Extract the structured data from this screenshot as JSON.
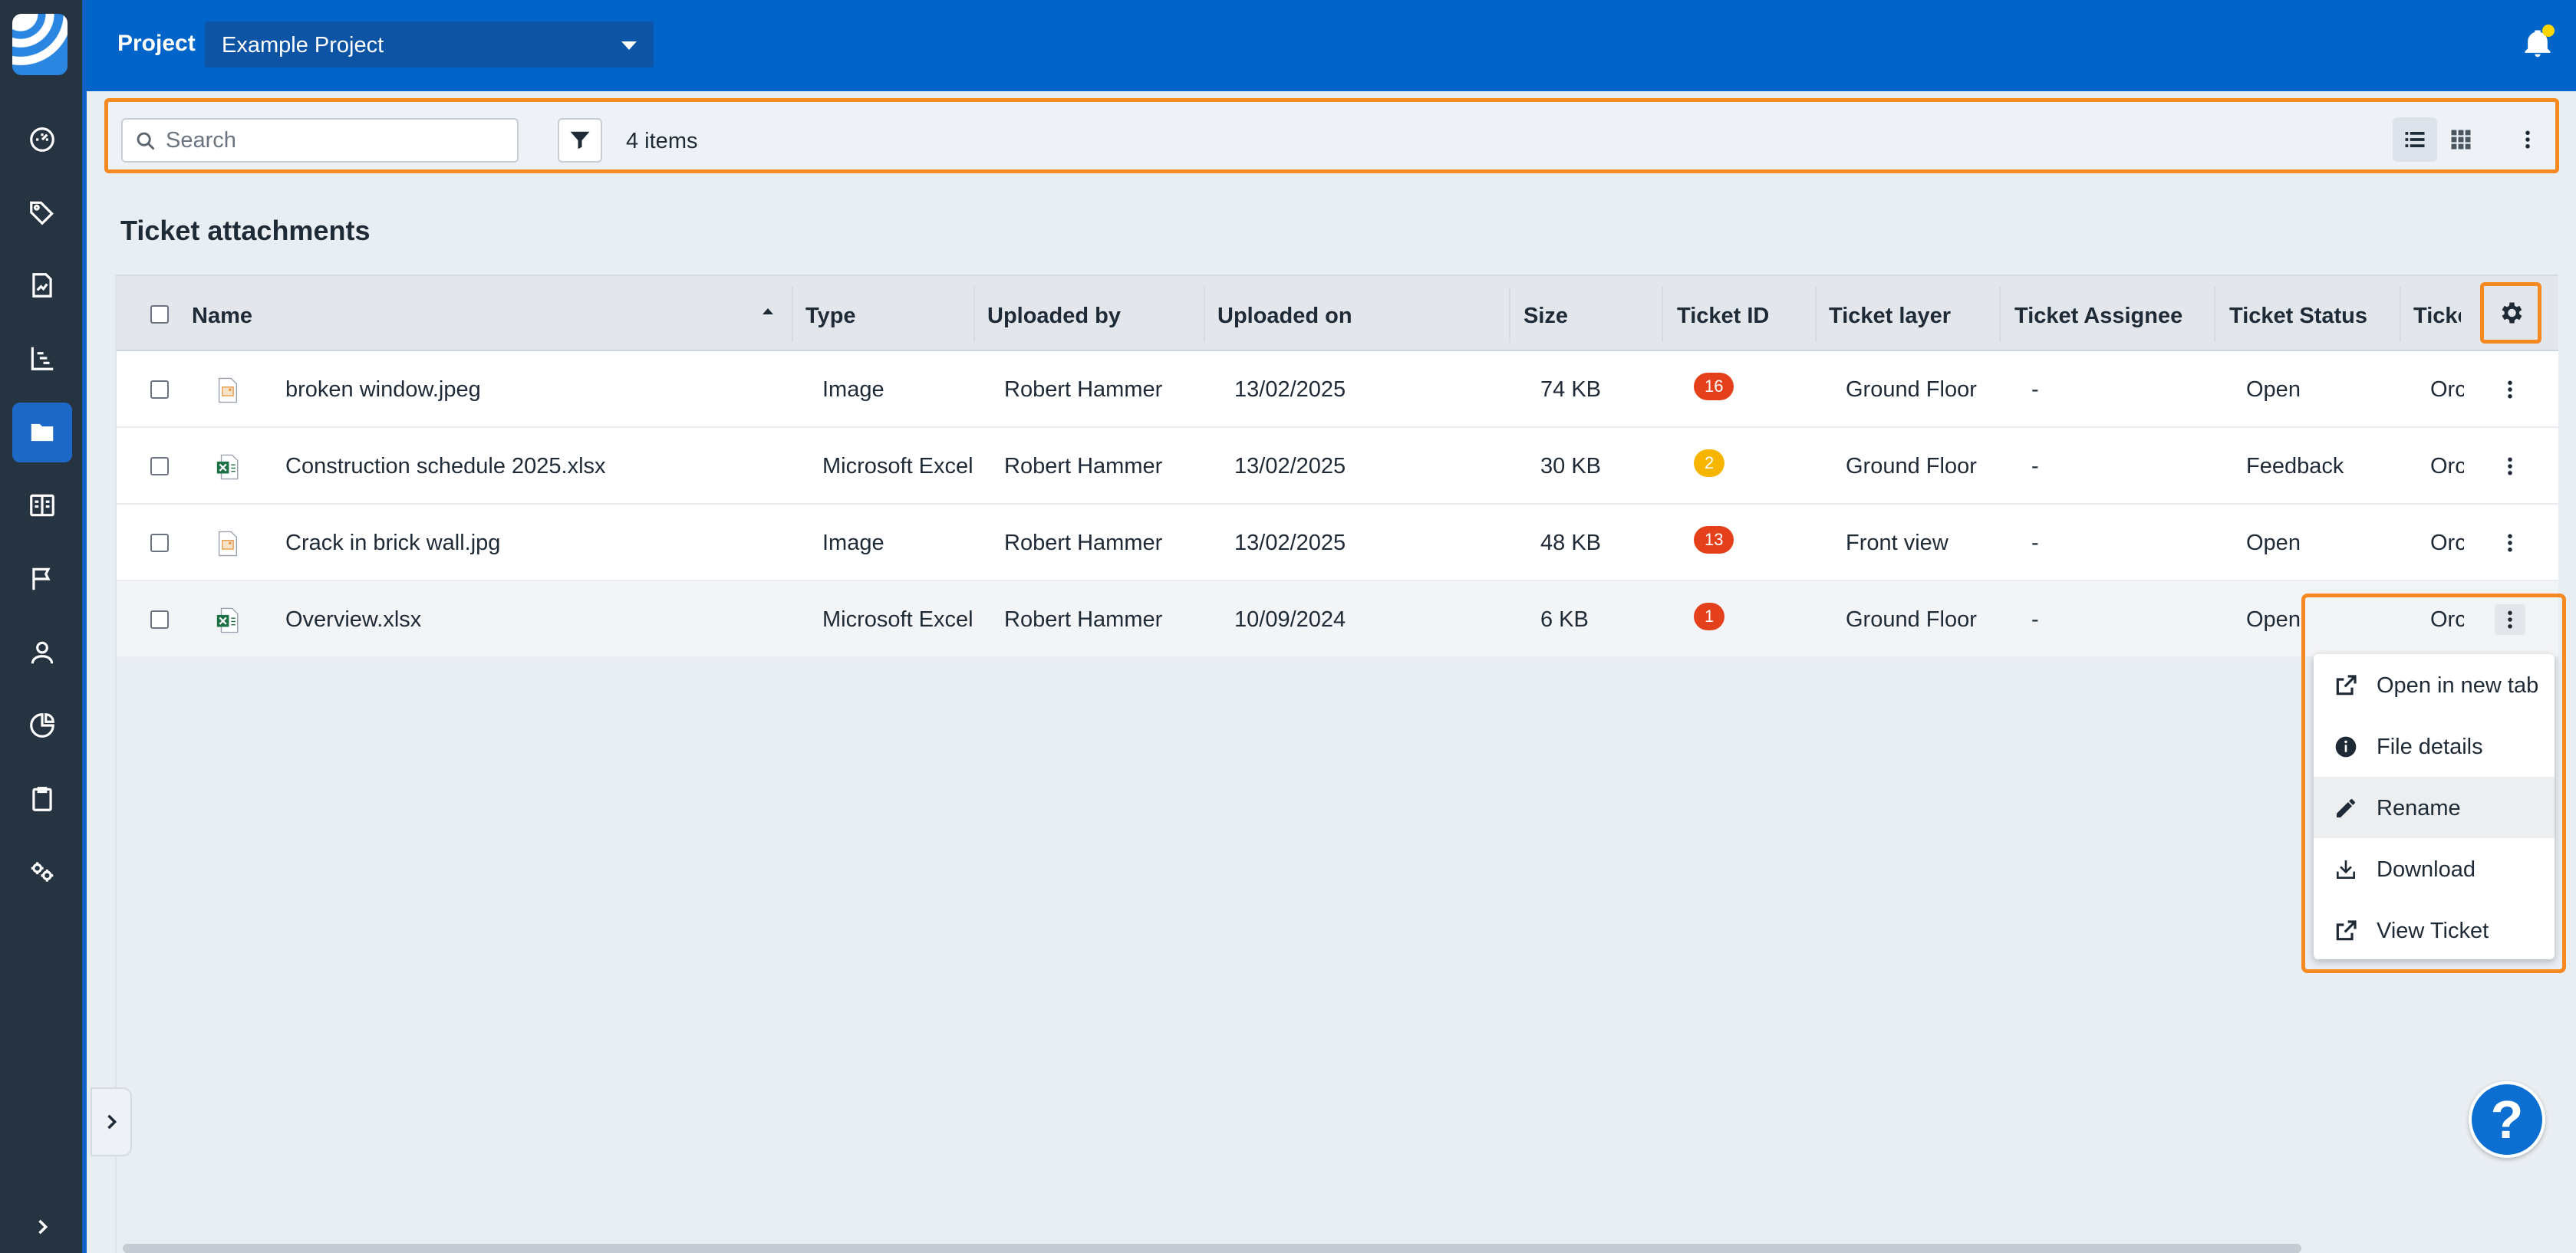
{
  "topbar": {
    "project_label": "Project",
    "project_value": "Example Project"
  },
  "toolbar": {
    "search_placeholder": "Search",
    "item_count": "4 items"
  },
  "page": {
    "title": "Ticket attachments"
  },
  "table": {
    "columns": [
      "Name",
      "Type",
      "Uploaded by",
      "Uploaded on",
      "Size",
      "Ticket ID",
      "Ticket layer",
      "Ticket Assignee",
      "Ticket Status",
      "Ticke"
    ],
    "rows": [
      {
        "name": "broken window.jpeg",
        "icon": "image-file-icon",
        "type": "Image",
        "uploaded_by": "Robert Hammer",
        "uploaded_on": "13/02/2025",
        "size": "74 KB",
        "ticket_id": "16",
        "badge_color": "#e4401b",
        "layer": "Ground Floor",
        "assignee": "-",
        "status": "Open",
        "extra": "Orc"
      },
      {
        "name": "Construction schedule 2025.xlsx",
        "icon": "excel-file-icon",
        "type": "Microsoft Excel",
        "uploaded_by": "Robert Hammer",
        "uploaded_on": "13/02/2025",
        "size": "30 KB",
        "ticket_id": "2",
        "badge_color": "#f7b500",
        "layer": "Ground Floor",
        "assignee": "-",
        "status": "Feedback",
        "extra": "Orc"
      },
      {
        "name": "Crack in brick wall.jpg",
        "icon": "image-file-icon",
        "type": "Image",
        "uploaded_by": "Robert Hammer",
        "uploaded_on": "13/02/2025",
        "size": "48 KB",
        "ticket_id": "13",
        "badge_color": "#e4401b",
        "layer": "Front view",
        "assignee": "-",
        "status": "Open",
        "extra": "Orc"
      },
      {
        "name": "Overview.xlsx",
        "icon": "excel-file-icon",
        "type": "Microsoft Excel",
        "uploaded_by": "Robert Hammer",
        "uploaded_on": "10/09/2024",
        "size": "6 KB",
        "ticket_id": "1",
        "badge_color": "#e4401b",
        "layer": "Ground Floor",
        "assignee": "-",
        "status": "Open",
        "extra": "Orc"
      }
    ]
  },
  "context_menu": [
    {
      "label": "Open in new tab",
      "icon": "external-link-icon"
    },
    {
      "label": "File details",
      "icon": "info-icon"
    },
    {
      "label": "Rename",
      "icon": "pencil-icon"
    },
    {
      "label": "Download",
      "icon": "download-icon"
    },
    {
      "label": "View Ticket",
      "icon": "external-link-icon"
    }
  ],
  "help": {
    "label": "?"
  },
  "colors": {
    "brand_blue": "#0064c8",
    "sidebar": "#263340",
    "highlight_orange": "#f6891f"
  }
}
